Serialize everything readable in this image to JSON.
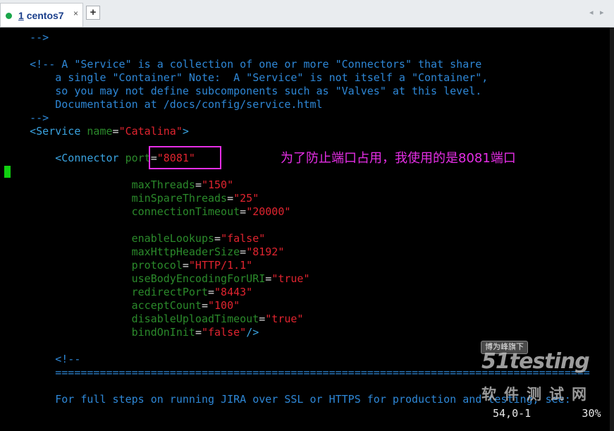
{
  "tab": {
    "number": "1",
    "title": "centos7",
    "close_glyph": "×"
  },
  "add_tab_glyph": "+",
  "nav": {
    "left_glyph": "◂",
    "right_glyph": "▸"
  },
  "lines": {
    "l1": "    -->",
    "l2": "    <!-- A \"Service\" is a collection of one or more \"Connectors\" that share",
    "l3": "        a single \"Container\" Note:  A \"Service\" is not itself a \"Container\",",
    "l4": "        so you may not define subcomponents such as \"Valves\" at this level.",
    "l5": "        Documentation at /docs/config/service.html",
    "l6": "    -->",
    "l7": {
      "tag_open": "    <Service",
      "attr": " name",
      "eq": "=",
      "val": "\"Catalina\"",
      "close": ">"
    },
    "l8": {
      "tag_open": "        <Connector",
      "attr": " port",
      "eq": "=",
      "val": "\"8081\""
    },
    "attrs": [
      {
        "name": "maxThreads",
        "value": "\"150\""
      },
      {
        "name": "minSpareThreads",
        "value": "\"25\""
      },
      {
        "name": "connectionTimeout",
        "value": "\"20000\""
      },
      {
        "name": "enableLookups",
        "value": "\"false\""
      },
      {
        "name": "maxHttpHeaderSize",
        "value": "\"8192\""
      },
      {
        "name": "protocol",
        "value": "\"HTTP/1.1\""
      },
      {
        "name": "useBodyEncodingForURI",
        "value": "\"true\""
      },
      {
        "name": "redirectPort",
        "value": "\"8443\""
      },
      {
        "name": "acceptCount",
        "value": "\"100\""
      },
      {
        "name": "disableUploadTimeout",
        "value": "\"true\""
      },
      {
        "name": "bindOnInit",
        "value": "\"false\"",
        "close": "/>"
      }
    ],
    "comment_open": "        <!--",
    "separator": "        ====================================================================================",
    "ssl_line": "        For full steps on running JIRA over SSL or HTTPS for production and testing, see:"
  },
  "annotation": "为了防止端口占用，我使用的是8081端口",
  "vim_status": "54,0-1        30%",
  "watermark": {
    "badge": "博为峰旗下",
    "logo": "51testing",
    "sub": "软件测试网"
  }
}
